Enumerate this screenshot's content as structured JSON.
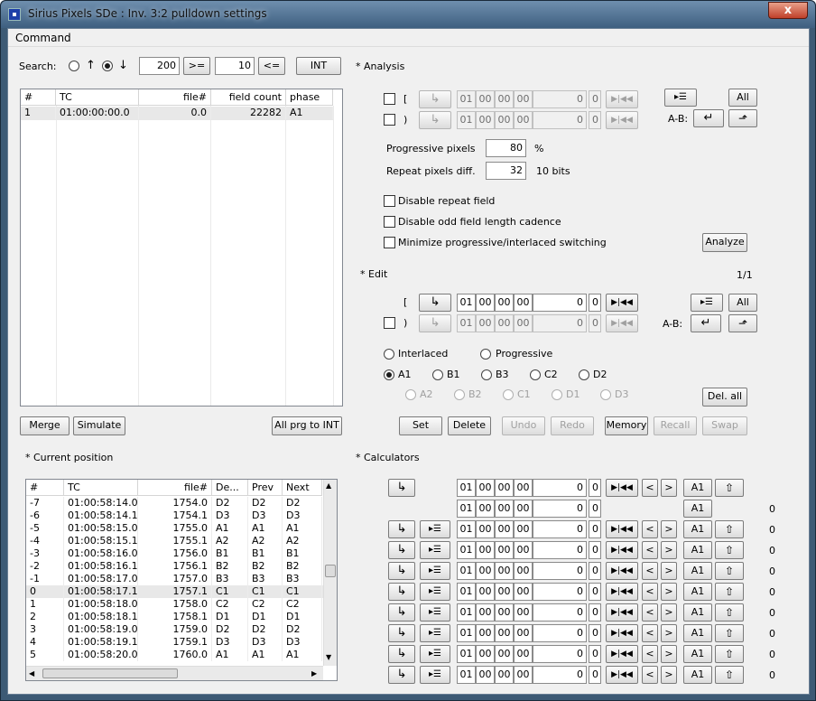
{
  "window": {
    "title": "Sirius Pixels SDe : Inv. 3:2 pulldown settings",
    "close": "x"
  },
  "menu": {
    "command": "Command"
  },
  "search": {
    "label": "Search:",
    "up": "↑",
    "down": "↓",
    "value1": "200",
    "ge": ">=",
    "value2": "10",
    "le": "<=",
    "int": "INT"
  },
  "phase_table": {
    "headers": [
      "#",
      "TC",
      "file#",
      "field count",
      "phase"
    ],
    "row": [
      "1",
      "01:00:00:00.0",
      "0.0",
      "22282",
      "A1"
    ]
  },
  "left_buttons": {
    "merge": "Merge",
    "simulate": "Simulate",
    "all_prg": "All prg to INT"
  },
  "analysis": {
    "title": "* Analysis",
    "in_mark": "[",
    "out_mark": ")",
    "tc": [
      "01",
      "00",
      "00",
      "00"
    ],
    "frame": "0",
    "field": "0",
    "all": "All",
    "ab": "A-B:",
    "progressive_label": "Progressive pixels",
    "progressive_value": "80",
    "progressive_unit": "%",
    "repeat_label": "Repeat pixels diff.",
    "repeat_value": "32",
    "repeat_unit": "10 bits",
    "chk1": "Disable repeat field",
    "chk2": "Disable odd field length cadence",
    "chk3": "Minimize progressive/interlaced switching",
    "analyze": "Analyze"
  },
  "edit": {
    "title": "* Edit",
    "count": "1/1",
    "in_mark": "[",
    "out_mark": ")",
    "tc": [
      "01",
      "00",
      "00",
      "00"
    ],
    "frame": "0",
    "field": "0",
    "all": "All",
    "ab": "A-B:",
    "interlaced": "Interlaced",
    "progressive": "Progressive",
    "phases1": [
      "A1",
      "B1",
      "B3",
      "C2",
      "D2"
    ],
    "phases2": [
      "A2",
      "B2",
      "C1",
      "D1",
      "D3"
    ],
    "del_all": "Del. all"
  },
  "edit_buttons": {
    "set": "Set",
    "delete": "Delete",
    "undo": "Undo",
    "redo": "Redo",
    "memory": "Memory",
    "recall": "Recall",
    "swap": "Swap"
  },
  "current": {
    "title": "* Current position",
    "headers": [
      "#",
      "TC",
      "file#",
      "De...",
      "Prev",
      "Next"
    ],
    "rows": [
      [
        "-7",
        "01:00:58:14.0",
        "1754.0",
        "D2",
        "D2",
        "D2"
      ],
      [
        "-6",
        "01:00:58:14.1",
        "1754.1",
        "D3",
        "D3",
        "D3"
      ],
      [
        "-5",
        "01:00:58:15.0",
        "1755.0",
        "A1",
        "A1",
        "A1"
      ],
      [
        "-4",
        "01:00:58:15.1",
        "1755.1",
        "A2",
        "A2",
        "A2"
      ],
      [
        "-3",
        "01:00:58:16.0",
        "1756.0",
        "B1",
        "B1",
        "B1"
      ],
      [
        "-2",
        "01:00:58:16.1",
        "1756.1",
        "B2",
        "B2",
        "B2"
      ],
      [
        "-1",
        "01:00:58:17.0",
        "1757.0",
        "B3",
        "B3",
        "B3"
      ],
      [
        "0",
        "01:00:58:17.1",
        "1757.1",
        "C1",
        "C1",
        "C1"
      ],
      [
        "1",
        "01:00:58:18.0",
        "1758.0",
        "C2",
        "C2",
        "C2"
      ],
      [
        "2",
        "01:00:58:18.1",
        "1758.1",
        "D1",
        "D1",
        "D1"
      ],
      [
        "3",
        "01:00:58:19.0",
        "1759.0",
        "D2",
        "D2",
        "D2"
      ],
      [
        "4",
        "01:00:58:19.1",
        "1759.1",
        "D3",
        "D3",
        "D3"
      ],
      [
        "5",
        "01:00:58:20.0",
        "1760.0",
        "A1",
        "A1",
        "A1"
      ]
    ]
  },
  "calculators": {
    "title": "* Calculators",
    "tc": [
      "01",
      "00",
      "00",
      "00"
    ],
    "frame": "0",
    "field": "0",
    "phase": "A1",
    "lt": "<",
    "gt": ">",
    "result": "0"
  }
}
